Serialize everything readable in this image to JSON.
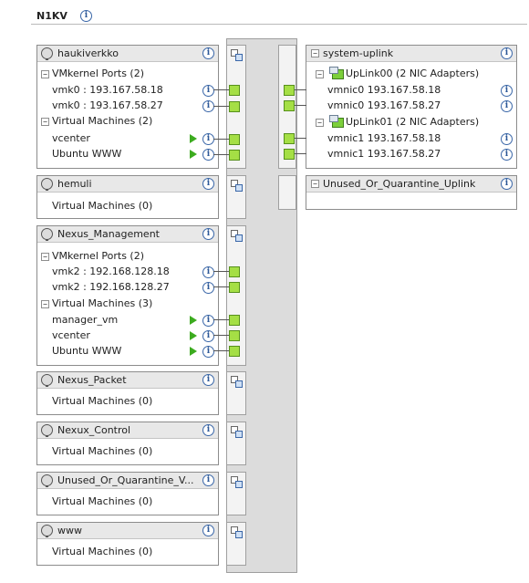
{
  "switch": {
    "name": "N1KV"
  },
  "port_groups": [
    {
      "name": "haukiverkko",
      "sections": [
        {
          "label": "VMkernel Ports (2)",
          "items": [
            "vmk0 : 193.167.58.18",
            "vmk0 : 193.167.58.27"
          ]
        },
        {
          "label": "Virtual Machines (2)",
          "items": [
            "vcenter",
            "Ubuntu WWW"
          ]
        }
      ]
    },
    {
      "name": "hemuli",
      "sections": [
        {
          "label": "Virtual Machines (0)",
          "items": []
        }
      ]
    },
    {
      "name": "Nexus_Management",
      "sections": [
        {
          "label": "VMkernel Ports (2)",
          "items": [
            "vmk2 : 192.168.128.18",
            "vmk2 : 192.168.128.27"
          ]
        },
        {
          "label": "Virtual Machines (3)",
          "items": [
            "manager_vm",
            "vcenter",
            "Ubuntu WWW"
          ]
        }
      ]
    },
    {
      "name": "Nexus_Packet",
      "sections": [
        {
          "label": "Virtual Machines (0)",
          "items": []
        }
      ]
    },
    {
      "name": "Nexux_Control",
      "sections": [
        {
          "label": "Virtual Machines (0)",
          "items": []
        }
      ]
    },
    {
      "name": "Unused_Or_Quarantine_V...",
      "sections": [
        {
          "label": "Virtual Machines (0)",
          "items": []
        }
      ]
    },
    {
      "name": "www",
      "sections": [
        {
          "label": "Virtual Machines (0)",
          "items": []
        }
      ]
    }
  ],
  "uplink_groups": [
    {
      "name": "system-uplink",
      "uplinks": [
        {
          "label": "UpLink00 (2 NIC Adapters)",
          "adapters": [
            "vmnic0 193.167.58.18",
            "vmnic0 193.167.58.27"
          ]
        },
        {
          "label": "UpLink01 (2 NIC Adapters)",
          "adapters": [
            "vmnic1 193.167.58.18",
            "vmnic1 193.167.58.27"
          ]
        }
      ]
    },
    {
      "name": "Unused_Or_Quarantine_Uplink",
      "uplinks": []
    }
  ],
  "icons": {
    "info": "info-icon",
    "portgroup": "portgroup-globe-icon",
    "collapse": "collapse-toggle-icon",
    "vm_power": "vm-powered-on-icon",
    "port": "port-connector-icon",
    "nic": "nic-adapter-icon",
    "gutter": "portgroup-settings-icon"
  },
  "colors": {
    "port_green": "#a5df45",
    "power_green": "#3cab1f",
    "info_blue": "#2b5797",
    "header_gray": "#e8e8e8",
    "trunk_gray": "#dcdcdc"
  }
}
